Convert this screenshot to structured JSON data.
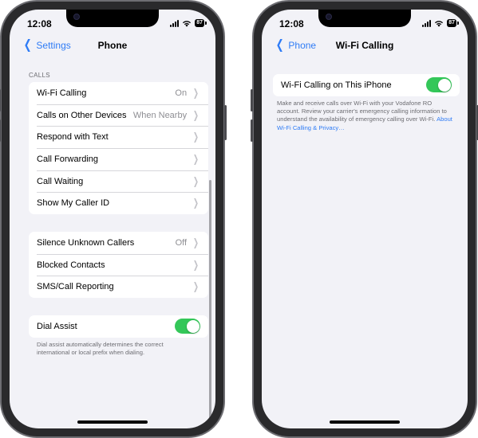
{
  "left_screen": {
    "status": {
      "time": "12:08",
      "battery": "87"
    },
    "nav": {
      "back_label": "Settings",
      "title": "Phone"
    },
    "calls_section_header": "CALLS",
    "calls_rows": [
      {
        "label": "Wi-Fi Calling",
        "value": "On"
      },
      {
        "label": "Calls on Other Devices",
        "value": "When Nearby"
      },
      {
        "label": "Respond with Text",
        "value": ""
      },
      {
        "label": "Call Forwarding",
        "value": ""
      },
      {
        "label": "Call Waiting",
        "value": ""
      },
      {
        "label": "Show My Caller ID",
        "value": ""
      }
    ],
    "blocking_rows": [
      {
        "label": "Silence Unknown Callers",
        "value": "Off"
      },
      {
        "label": "Blocked Contacts",
        "value": ""
      },
      {
        "label": "SMS/Call Reporting",
        "value": ""
      }
    ],
    "dial_assist": {
      "label": "Dial Assist",
      "enabled": true,
      "footer": "Dial assist automatically determines the correct international or local prefix when dialing."
    }
  },
  "right_screen": {
    "status": {
      "time": "12:08",
      "battery": "87"
    },
    "nav": {
      "back_label": "Phone",
      "title": "Wi-Fi Calling"
    },
    "wifi_calling_row": {
      "label": "Wi-Fi Calling on This iPhone",
      "enabled": true
    },
    "footer": {
      "text": "Make and receive calls over Wi-Fi with your Vodafone RO account. Review your carrier's emergency calling information to understand the availability of emergency calling over Wi-Fi. ",
      "link": "About Wi-Fi Calling & Privacy…"
    }
  },
  "colors": {
    "accent": "#2f7cf6",
    "toggle_on": "#34c759",
    "background": "#f2f2f7",
    "secondary_text": "#8e8e93"
  },
  "icons": [
    "chevron-left-icon",
    "chevron-right-icon",
    "cellular-signal-icon",
    "wifi-icon",
    "battery-icon"
  ]
}
